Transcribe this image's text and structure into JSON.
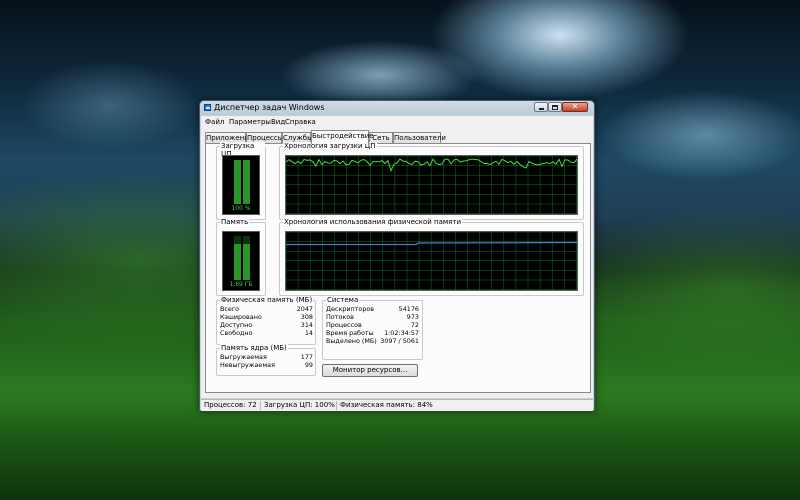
{
  "window": {
    "title": "Диспетчер задач Windows",
    "close_glyph": "✕"
  },
  "menu": {
    "file": "Файл",
    "options": "Параметры",
    "view": "Вид",
    "help": "Справка"
  },
  "tabs": {
    "apps": "Приложения",
    "processes": "Процессы",
    "services": "Службы",
    "performance": "Быстродействие",
    "network": "Сеть",
    "users": "Пользователи",
    "active": "performance"
  },
  "performance": {
    "cpu_usage": {
      "label": "Загрузка ЦП",
      "caption": "100 %",
      "level": 1.0
    },
    "cpu_history": {
      "label": "Хронология загрузки ЦП"
    },
    "memory": {
      "label": "Память",
      "caption": "1,69 ГБ",
      "level": 0.84
    },
    "memory_history": {
      "label": "Хронология использования физической памяти"
    },
    "physical_memory": {
      "label": "Физическая память (МБ)",
      "rows": [
        {
          "label": "Всего",
          "value": "2047"
        },
        {
          "label": "Кэшировано",
          "value": "308"
        },
        {
          "label": "Доступно",
          "value": "314"
        },
        {
          "label": "Свободно",
          "value": "14"
        }
      ]
    },
    "kernel_memory": {
      "label": "Память ядра (МБ)",
      "rows": [
        {
          "label": "Выгружаемая",
          "value": "177"
        },
        {
          "label": "Невыгружаемая",
          "value": "99"
        }
      ]
    },
    "system": {
      "label": "Система",
      "rows": [
        {
          "label": "Дескрипторов",
          "value": "54176"
        },
        {
          "label": "Потоков",
          "value": "973"
        },
        {
          "label": "Процессов",
          "value": "72"
        },
        {
          "label": "Время работы",
          "value": "1:02:34:57"
        },
        {
          "label": "Выделено (МБ)",
          "value": "3097 / 5061"
        }
      ]
    },
    "resource_monitor_button": "Монитор ресурсов..."
  },
  "status_bar": {
    "processes": "Процессов: 72",
    "cpu": "Загрузка ЦП: 100%",
    "memory": "Физическая память: 84%"
  },
  "colors": {
    "meter_green": "#3bd63b",
    "meter_dark": "#0f4a0f",
    "grid": "#0a7a20",
    "cpu_line": "#3fe23f",
    "memory_line": "#3a7fd8"
  }
}
